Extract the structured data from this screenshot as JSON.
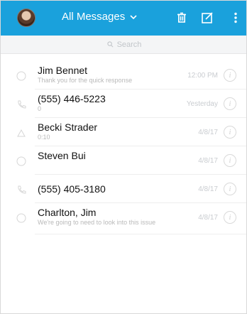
{
  "header": {
    "title": "All Messages",
    "bg_color": "#1aa1dc",
    "icons": [
      "avatar",
      "chevron-down-icon",
      "trash-icon",
      "compose-icon",
      "more-vert-icon"
    ]
  },
  "search": {
    "placeholder": "Search"
  },
  "conversations": [
    {
      "name": "Jim Bennet",
      "preview": "Thank you for the quick response",
      "date": "12:00 PM"
    },
    {
      "name": "(555) 446-5223",
      "preview": "0",
      "date": "Yesterday"
    },
    {
      "name": "Becki Strader",
      "preview": "0:10",
      "date": "4/8/17"
    },
    {
      "name": "Steven Bui",
      "preview": "",
      "date": "4/8/17"
    },
    {
      "name": "(555) 405-3180",
      "preview": "",
      "date": "4/8/17"
    },
    {
      "name": "Charlton, Jim",
      "preview": "We're going to need to look into this issue",
      "date": "4/8/17"
    }
  ]
}
